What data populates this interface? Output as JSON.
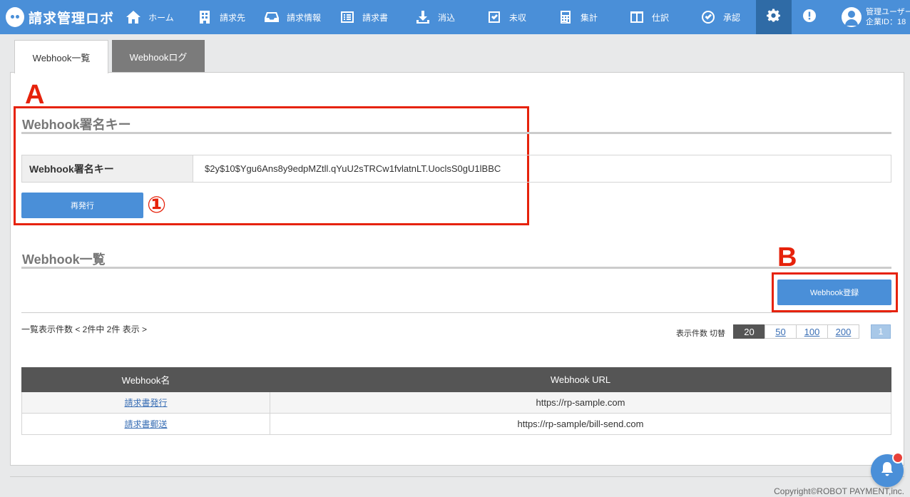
{
  "app": {
    "logo_text": "請求管理ロボ"
  },
  "nav": [
    {
      "label": "ホーム",
      "icon": "home-icon"
    },
    {
      "label": "請求先",
      "icon": "building-icon"
    },
    {
      "label": "請求情報",
      "icon": "inbox-icon"
    },
    {
      "label": "請求書",
      "icon": "document-list-icon"
    },
    {
      "label": "消込",
      "icon": "download-icon"
    },
    {
      "label": "未収",
      "icon": "checkbox-icon"
    },
    {
      "label": "集計",
      "icon": "calculator-icon"
    },
    {
      "label": "仕訳",
      "icon": "columns-icon"
    },
    {
      "label": "承認",
      "icon": "check-circle-icon"
    }
  ],
  "user": {
    "name": "管理ユーザー",
    "company_id": "企業ID：18"
  },
  "tabs": {
    "active": "Webhook一覧",
    "inactive": "Webhookログ"
  },
  "annotations": {
    "a": "A",
    "b": "B",
    "circle1": "①"
  },
  "signature": {
    "title": "Webhook署名キー",
    "label": "Webhook署名キー",
    "value": "$2y$10$Ygu6Ans8y9edpMZtll.qYuU2sTRCw1fvlatnLT.UoclsS0gU1lBBC",
    "reissue_button": "再発行"
  },
  "webhook_list": {
    "title": "Webhook一覧",
    "register_button": "Webhook登録",
    "count_text": "一覧表示件数 < 2件中 2件 表示 >",
    "per_page_label": "表示件数 切替",
    "per_page_options": [
      "20",
      "50",
      "100",
      "200"
    ],
    "per_page_selected": "20",
    "current_page": "1",
    "columns": [
      "Webhook名",
      "Webhook URL"
    ],
    "rows": [
      {
        "name": "請求書発行",
        "url": "https://rp-sample.com"
      },
      {
        "name": "請求書郵送",
        "url": "https://rp-sample/bill-send.com"
      }
    ]
  },
  "footer": {
    "copyright": "Copyright©ROBOT PAYMENT,inc."
  },
  "colors": {
    "primary": "#4a8fd8",
    "annotation": "#e6220b",
    "table_header": "#555555"
  }
}
